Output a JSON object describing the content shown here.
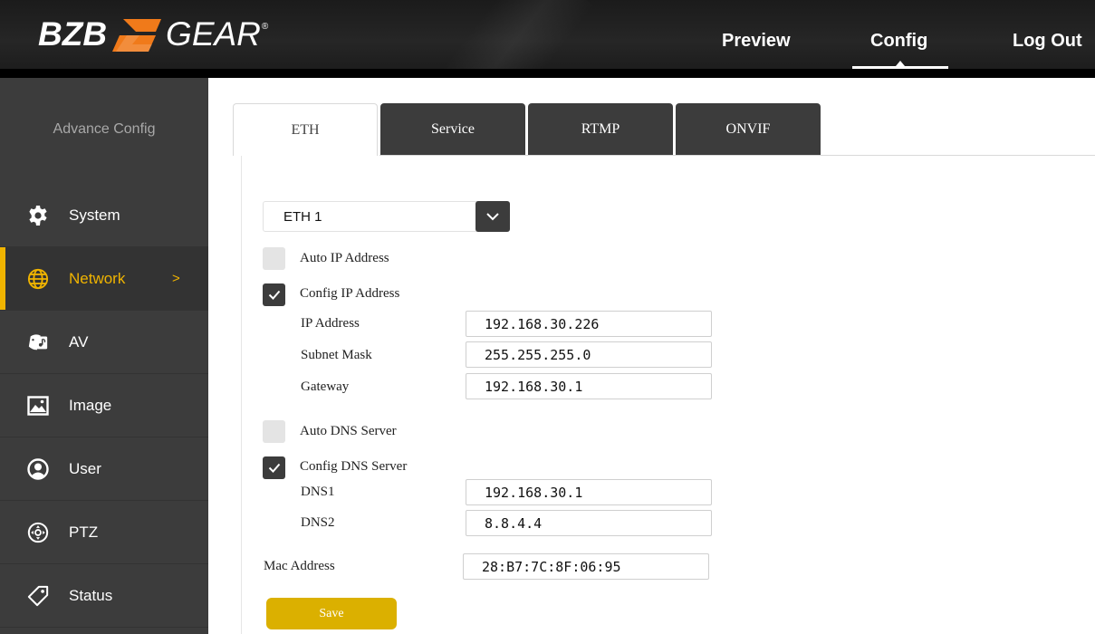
{
  "brand": {
    "left": "BZB",
    "right": "GEAR",
    "mark": "®",
    "accent_color": "#F07A1A"
  },
  "topnav": {
    "preview": "Preview",
    "config": "Config",
    "logout": "Log Out"
  },
  "sidebar": {
    "title": "Advance Config",
    "items": [
      {
        "label": "System",
        "icon": "gear-icon"
      },
      {
        "label": "Network",
        "icon": "globe-icon",
        "active": true,
        "chevron": ">"
      },
      {
        "label": "AV",
        "icon": "av-icon"
      },
      {
        "label": "Image",
        "icon": "image-icon"
      },
      {
        "label": "User",
        "icon": "user-icon"
      },
      {
        "label": "PTZ",
        "icon": "ptz-icon"
      },
      {
        "label": "Status",
        "icon": "tag-icon"
      }
    ],
    "active_color": "#F0B400"
  },
  "tabs": [
    {
      "label": "ETH",
      "active": true
    },
    {
      "label": "Service"
    },
    {
      "label": "RTMP"
    },
    {
      "label": "ONVIF"
    }
  ],
  "form": {
    "interface_select": {
      "value": "ETH 1"
    },
    "auto_ip": {
      "label": "Auto IP Address",
      "checked": false
    },
    "config_ip": {
      "label": "Config IP Address",
      "checked": true
    },
    "ip_address": {
      "label": "IP Address",
      "value": "192.168.30.226"
    },
    "subnet_mask": {
      "label": "Subnet Mask",
      "value": "255.255.255.0"
    },
    "gateway": {
      "label": "Gateway",
      "value": "192.168.30.1"
    },
    "auto_dns": {
      "label": "Auto DNS Server",
      "checked": false
    },
    "config_dns": {
      "label": "Config DNS Server",
      "checked": true
    },
    "dns1": {
      "label": "DNS1",
      "value": "192.168.30.1"
    },
    "dns2": {
      "label": "DNS2",
      "value": "8.8.4.4"
    },
    "mac_address": {
      "label": "Mac Address",
      "value": "28:B7:7C:8F:06:95"
    },
    "save_label": "Save",
    "save_color": "#DBB000"
  }
}
